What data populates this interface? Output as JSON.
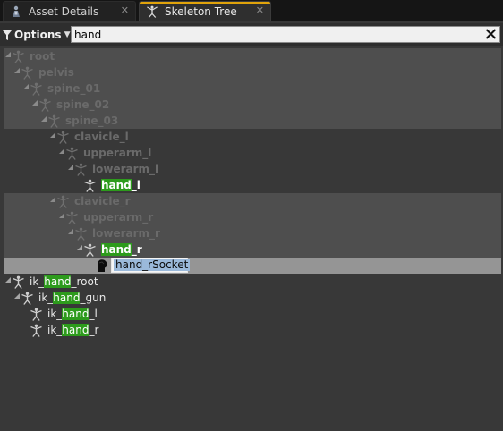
{
  "tabs": [
    {
      "label": "Asset Details",
      "icon": "asset-details-icon",
      "active": false
    },
    {
      "label": "Skeleton Tree",
      "icon": "skeleton-bone-icon",
      "active": true
    }
  ],
  "toolbar": {
    "options_label": "Options"
  },
  "search": {
    "value": "hand"
  },
  "colors": {
    "match_highlight": "#2d9b1c",
    "active_tab_accent": "#e0a30b",
    "selection": "#959595",
    "text_selection": "#9bb9da"
  },
  "tree": [
    {
      "pre": "",
      "match": "",
      "post": "root",
      "state": "dim"
    },
    {
      "pre": "",
      "match": "",
      "post": "pelvis",
      "state": "dim"
    },
    {
      "pre": "",
      "match": "",
      "post": "spine_01",
      "state": "dim"
    },
    {
      "pre": "",
      "match": "",
      "post": "spine_02",
      "state": "dim"
    },
    {
      "pre": "",
      "match": "",
      "post": "spine_03",
      "state": "dim"
    },
    {
      "pre": "",
      "match": "",
      "post": "clavicle_l",
      "state": "dim"
    },
    {
      "pre": "",
      "match": "",
      "post": "upperarm_l",
      "state": "dim"
    },
    {
      "pre": "",
      "match": "",
      "post": "lowerarm_l",
      "state": "dim"
    },
    {
      "pre": "",
      "match": "hand",
      "post": "_l",
      "state": "match"
    },
    {
      "pre": "",
      "match": "",
      "post": "clavicle_r",
      "state": "dim"
    },
    {
      "pre": "",
      "match": "",
      "post": "upperarm_r",
      "state": "dim"
    },
    {
      "pre": "",
      "match": "",
      "post": "lowerarm_r",
      "state": "dim"
    },
    {
      "pre": "",
      "match": "hand",
      "post": "_r",
      "state": "match"
    },
    {
      "pre": "",
      "match": "",
      "post": "hand_rSocket",
      "state": "socket"
    },
    {
      "pre": "ik_",
      "match": "hand",
      "post": "_root",
      "state": "norm"
    },
    {
      "pre": "ik_",
      "match": "hand",
      "post": "_gun",
      "state": "norm"
    },
    {
      "pre": "ik_",
      "match": "hand",
      "post": "_l",
      "state": "norm"
    },
    {
      "pre": "ik_",
      "match": "hand",
      "post": "_r",
      "state": "norm"
    }
  ]
}
